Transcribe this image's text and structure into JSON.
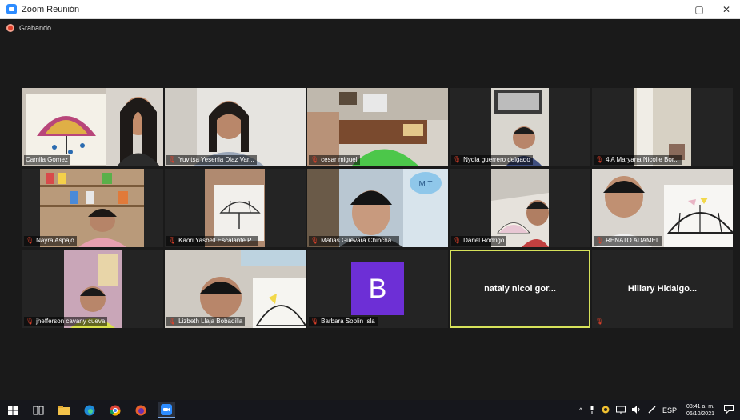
{
  "window": {
    "title": "Zoom Reunión",
    "controls": {
      "minimize": "–",
      "maximize": "▢",
      "close": "✕"
    }
  },
  "recording": {
    "label": "Grabando"
  },
  "participants": [
    "Camila Gomez",
    "Yuvitsa Yesenia Diaz Var...",
    "cesar miguel",
    "Nydia guerrero delgado",
    "4 A Maryana Nicolle Bor...",
    "Nayra Aspajo",
    "Kaori Yasbell Escalante P...",
    "Matias Guevara Chincha...",
    "Dariel Rodrigo",
    "RENATO ADAMEL",
    "jhefferson cavany cueva",
    "Lizbeth Llaja Bobadilla",
    "Barbara Soplin Isla",
    "nataly nicol gor...",
    "Hillary Hidalgo..."
  ],
  "avatar_letter": "B",
  "scene_text": {
    "mt_poster": "M T"
  },
  "taskbar": {
    "icons": [
      "windows-icon",
      "task-view-icon",
      "file-explorer-icon",
      "edge-icon",
      "chrome-icon",
      "firefox-icon",
      "zoom-icon"
    ],
    "tray": {
      "chevron": "^",
      "lang": "ESP"
    },
    "time": "08:41 a. m.",
    "date": "06/10/2021"
  },
  "colors": {
    "active_speaker_border": "#d6e25a",
    "mic_muted": "#e0402a",
    "avatar_bg": "#6d2fd6",
    "zoom_blue": "#2d8cff"
  }
}
